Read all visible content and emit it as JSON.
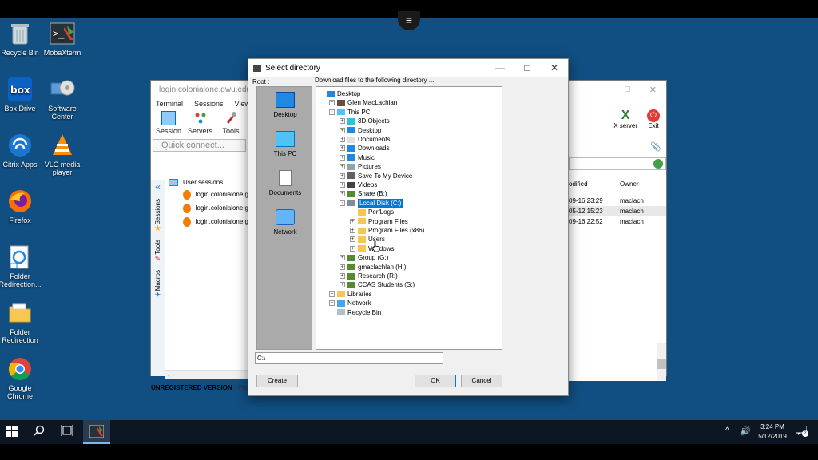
{
  "desktop_icons": [
    {
      "label": "Recycle Bin",
      "icon": "recycle-bin-icon"
    },
    {
      "label": "MobaXterm",
      "icon": "mobaxterm-icon"
    },
    {
      "label": "Box Drive",
      "icon": "box-drive-icon"
    },
    {
      "label": "Software Center",
      "icon": "software-center-icon"
    },
    {
      "label": "Citrix Apps",
      "icon": "citrix-icon"
    },
    {
      "label": "VLC media player",
      "icon": "vlc-icon"
    },
    {
      "label": "Firefox",
      "icon": "firefox-icon"
    },
    {
      "label": "Folder Redirection...",
      "icon": "folder-redirection-shortcut-icon"
    },
    {
      "label": "Folder Redirection",
      "icon": "folder-icon"
    },
    {
      "label": "Google Chrome",
      "icon": "chrome-icon"
    }
  ],
  "moba": {
    "title": "login.colonialone.gwu.edu",
    "menu": [
      "Terminal",
      "Sessions",
      "View"
    ],
    "tools": [
      "Session",
      "Servers",
      "Tools"
    ],
    "quick_connect_placeholder": "Quick connect...",
    "side_tabs": [
      "Sessions",
      "Tools",
      "Macros"
    ],
    "user_sessions_label": "User sessions",
    "sessions": [
      "login.colonialone.g",
      "login.colonialone.g",
      "login.colonialone.g"
    ],
    "status": "UNREGISTERED VERSION",
    "status_tail": "- Ple",
    "right_tools": [
      "X server",
      "Exit"
    ],
    "file_header_modified": "odified",
    "file_header_owner": "Owner",
    "files": [
      {
        "date": "09-16 23:29",
        "owner": "maclach"
      },
      {
        "date": "05-12 15:23",
        "owner": "maclach"
      },
      {
        "date": "09-16 22:52",
        "owner": "maclach"
      }
    ]
  },
  "dialog": {
    "title": "Select directory",
    "root_label": "Root :",
    "download_label": "Download files to the following directory ...",
    "places": [
      "Desktop",
      "This PC",
      "Documents",
      "Network"
    ],
    "tree": [
      {
        "label": "Desktop",
        "level": 0,
        "exp": "",
        "icon": "desktop-icon"
      },
      {
        "label": "Glen MacLachlan",
        "level": 1,
        "exp": "+",
        "icon": "user-icon"
      },
      {
        "label": "This PC",
        "level": 1,
        "exp": "-",
        "icon": "computer-icon"
      },
      {
        "label": "3D Objects",
        "level": 2,
        "exp": "+",
        "icon": "3d-objects-icon"
      },
      {
        "label": "Desktop",
        "level": 2,
        "exp": "+",
        "icon": "desktop-icon"
      },
      {
        "label": "Documents",
        "level": 2,
        "exp": "+",
        "icon": "documents-icon"
      },
      {
        "label": "Downloads",
        "level": 2,
        "exp": "+",
        "icon": "downloads-icon"
      },
      {
        "label": "Music",
        "level": 2,
        "exp": "+",
        "icon": "music-icon"
      },
      {
        "label": "Pictures",
        "level": 2,
        "exp": "+",
        "icon": "pictures-icon"
      },
      {
        "label": "Save To My Device",
        "level": 2,
        "exp": "+",
        "icon": "device-icon"
      },
      {
        "label": "Videos",
        "level": 2,
        "exp": "+",
        "icon": "videos-icon"
      },
      {
        "label": "Share (B:)",
        "level": 2,
        "exp": "+",
        "icon": "network-drive-icon"
      },
      {
        "label": "Local Disk (C:)",
        "level": 2,
        "exp": "-",
        "icon": "local-disk-icon",
        "selected": true
      },
      {
        "label": "PerfLogs",
        "level": 3,
        "exp": "",
        "icon": "folder-icon"
      },
      {
        "label": "Program Files",
        "level": 3,
        "exp": "+",
        "icon": "folder-icon"
      },
      {
        "label": "Program Files (x86)",
        "level": 3,
        "exp": "+",
        "icon": "folder-icon"
      },
      {
        "label": "Users",
        "level": 3,
        "exp": "+",
        "icon": "folder-icon"
      },
      {
        "label": "Windows",
        "level": 3,
        "exp": "+",
        "icon": "folder-icon"
      },
      {
        "label": "Group (G:)",
        "level": 2,
        "exp": "+",
        "icon": "network-drive-icon"
      },
      {
        "label": "gmaclachlan (H:)",
        "level": 2,
        "exp": "+",
        "icon": "network-drive-icon"
      },
      {
        "label": "Research (R:)",
        "level": 2,
        "exp": "+",
        "icon": "network-drive-icon"
      },
      {
        "label": "CCAS Students (S:)",
        "level": 2,
        "exp": "+",
        "icon": "network-drive-icon"
      },
      {
        "label": "Libraries",
        "level": 1,
        "exp": "+",
        "icon": "libraries-icon"
      },
      {
        "label": "Network",
        "level": 1,
        "exp": "+",
        "icon": "network-icon"
      },
      {
        "label": "Recycle Bin",
        "level": 1,
        "exp": "",
        "icon": "recycle-bin-icon"
      }
    ],
    "path_value": "C:\\",
    "create_label": "Create",
    "ok_label": "OK",
    "cancel_label": "Cancel"
  },
  "taskbar": {
    "time": "3:24 PM",
    "date": "5/12/2019",
    "notif_count": "2"
  },
  "colors": {
    "desktop": "#114f82",
    "selection": "#0078d7"
  }
}
